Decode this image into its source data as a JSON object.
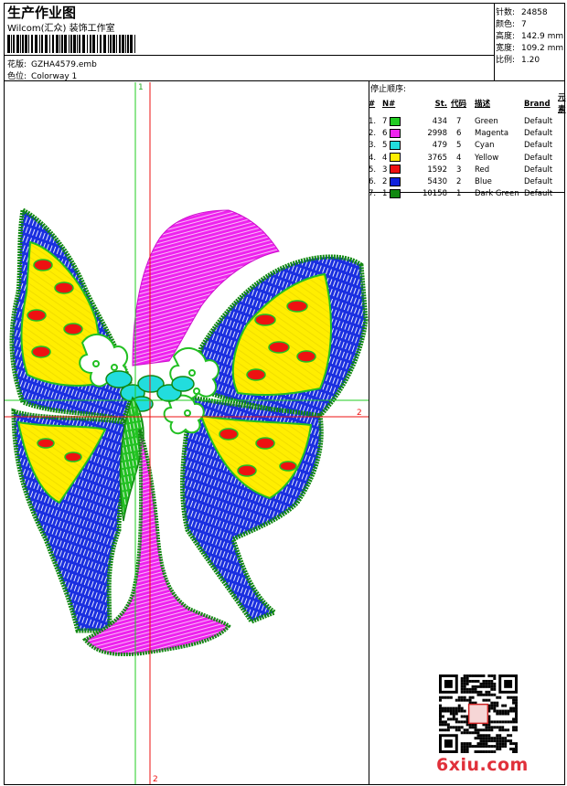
{
  "header": {
    "title": "生产作业图",
    "company": "Wilcom(汇众) 装饰工作室",
    "design_label": "花版:",
    "design_value": "GZHA4579.emb",
    "colorway_label": "色位:",
    "colorway_value": "Colorway 1"
  },
  "stats": [
    {
      "label": "针数:",
      "value": "24858"
    },
    {
      "label": "颜色:",
      "value": "7"
    },
    {
      "label": "高度:",
      "value": "142.9 mm"
    },
    {
      "label": "宽度:",
      "value": "109.2 mm"
    },
    {
      "label": "比例:",
      "value": "1.20"
    }
  ],
  "stop_sequence": {
    "title": "停止顺序:",
    "headers": {
      "num": "#",
      "n": "N#",
      "st": "St.",
      "code": "代码",
      "desc": "描述",
      "brand": "Brand",
      "elem": "元素"
    },
    "rows": [
      {
        "num": "1.",
        "n": "7",
        "color": "#22cc22",
        "st": "434",
        "code": "7",
        "desc": "Green",
        "brand": "Default"
      },
      {
        "num": "2.",
        "n": "6",
        "color": "#ee22ee",
        "st": "2998",
        "code": "6",
        "desc": "Magenta",
        "brand": "Default"
      },
      {
        "num": "3.",
        "n": "5",
        "color": "#22dddd",
        "st": "479",
        "code": "5",
        "desc": "Cyan",
        "brand": "Default"
      },
      {
        "num": "4.",
        "n": "4",
        "color": "#ffee00",
        "st": "3765",
        "code": "4",
        "desc": "Yellow",
        "brand": "Default"
      },
      {
        "num": "5.",
        "n": "3",
        "color": "#ee1111",
        "st": "1592",
        "code": "3",
        "desc": "Red",
        "brand": "Default"
      },
      {
        "num": "6.",
        "n": "2",
        "color": "#1122dd",
        "st": "5430",
        "code": "2",
        "desc": "Blue",
        "brand": "Default"
      },
      {
        "num": "7.",
        "n": "1",
        "color": "#118811",
        "st": "10158",
        "code": "1",
        "desc": "Dark Green",
        "brand": "Default"
      }
    ]
  },
  "axes": {
    "marker_1": "1",
    "marker_2": "2"
  },
  "watermark": "6xiu.com"
}
